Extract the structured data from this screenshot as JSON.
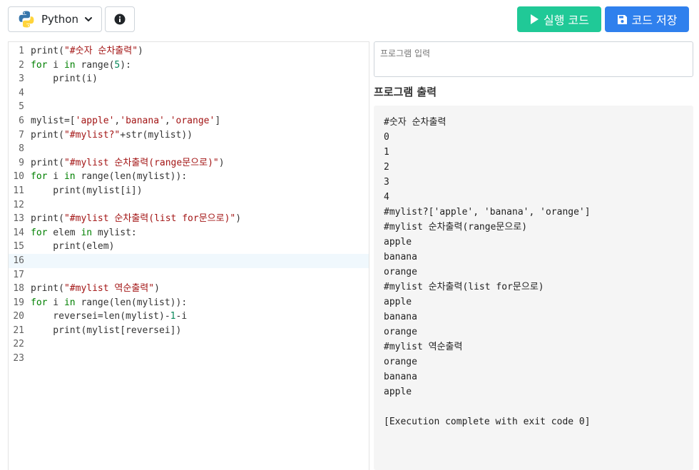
{
  "toolbar": {
    "language_label": "Python",
    "language_icon": "python-logo-icon",
    "info_icon": "info-circle-icon",
    "run_label": "실행 코드",
    "save_label": "코드 저장",
    "run_color": "#20c997",
    "save_color": "#2f80ed"
  },
  "editor": {
    "active_line": 16,
    "lines": [
      {
        "n": "1",
        "text": "print(\"#숫자 순차출력\")"
      },
      {
        "n": "2",
        "text": "for i in range(5):"
      },
      {
        "n": "3",
        "text": "    print(i)"
      },
      {
        "n": "4",
        "text": ""
      },
      {
        "n": "5",
        "text": ""
      },
      {
        "n": "6",
        "text": "mylist=['apple','banana','orange']"
      },
      {
        "n": "7",
        "text": "print(\"#mylist?\"+str(mylist))"
      },
      {
        "n": "8",
        "text": ""
      },
      {
        "n": "9",
        "text": "print(\"#mylist 순차출력(range문으로)\")"
      },
      {
        "n": "10",
        "text": "for i in range(len(mylist)):"
      },
      {
        "n": "11",
        "text": "    print(mylist[i])"
      },
      {
        "n": "12",
        "text": ""
      },
      {
        "n": "13",
        "text": "print(\"#mylist 순차출력(list for문으로)\")"
      },
      {
        "n": "14",
        "text": "for elem in mylist:"
      },
      {
        "n": "15",
        "text": "    print(elem)"
      },
      {
        "n": "16",
        "text": ""
      },
      {
        "n": "17",
        "text": ""
      },
      {
        "n": "18",
        "text": "print(\"#mylist 역순출력\")"
      },
      {
        "n": "19",
        "text": "for i in range(len(mylist)):"
      },
      {
        "n": "20",
        "text": "    reversei=len(mylist)-1-i"
      },
      {
        "n": "21",
        "text": "    print(mylist[reversei])"
      },
      {
        "n": "22",
        "text": ""
      },
      {
        "n": "23",
        "text": ""
      }
    ]
  },
  "input": {
    "placeholder": "프로그램 입력",
    "value": ""
  },
  "output": {
    "title": "프로그램 출력",
    "lines": [
      "#숫자 순차출력",
      "0",
      "1",
      "2",
      "3",
      "4",
      "#mylist?['apple', 'banana', 'orange']",
      "#mylist 순차출력(range문으로)",
      "apple",
      "banana",
      "orange",
      "#mylist 순차출력(list for문으로)",
      "apple",
      "banana",
      "orange",
      "#mylist 역순출력",
      "orange",
      "banana",
      "apple",
      "",
      "[Execution complete with exit code 0]"
    ]
  }
}
